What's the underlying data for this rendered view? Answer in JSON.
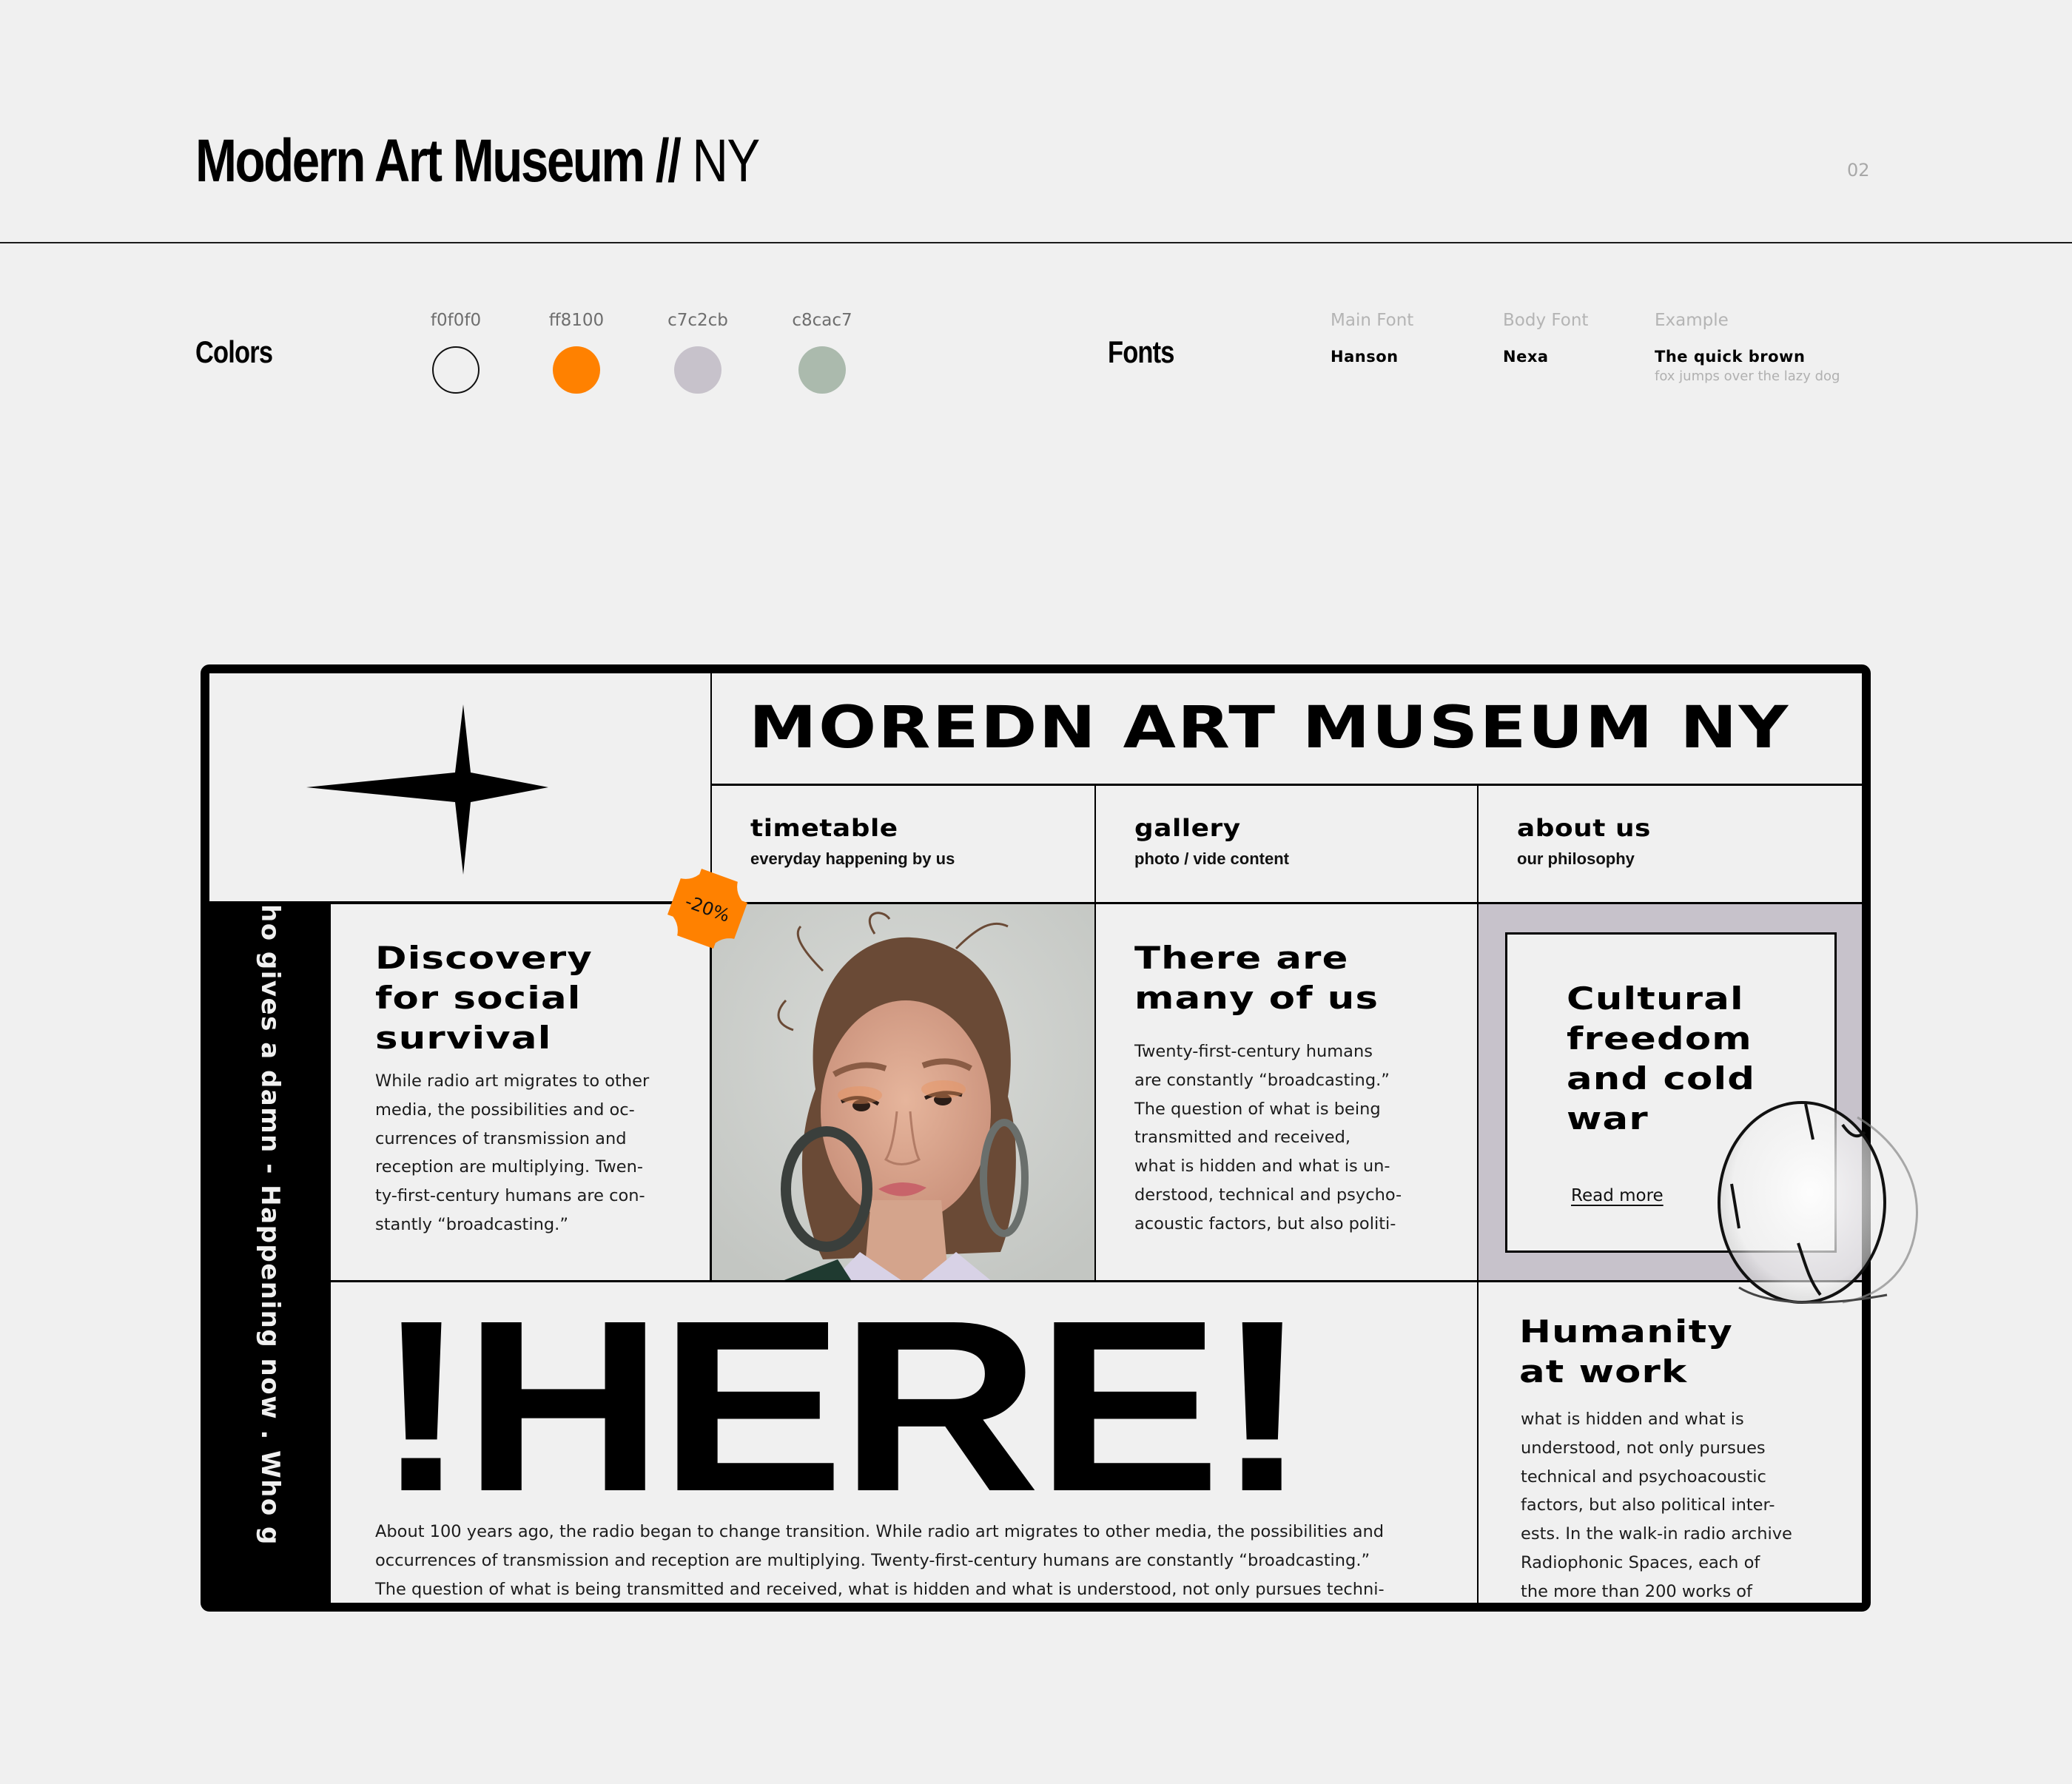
{
  "header": {
    "title_main": "Modern Art Museum",
    "title_separator": " //",
    "title_suffix": " NY",
    "page_number": "02"
  },
  "colors": {
    "label": "Colors",
    "swatches": [
      {
        "hex": "f0f0f0",
        "value": "#f0f0f0",
        "outlined": true
      },
      {
        "hex": "ff8100",
        "value": "#ff8100",
        "outlined": false
      },
      {
        "hex": "c7c2cb",
        "value": "#c7c2cb",
        "outlined": false
      },
      {
        "hex": "c8cac7",
        "value": "#c8cac7",
        "outlined": false
      }
    ]
  },
  "fonts": {
    "label": "Fonts",
    "main": {
      "label": "Main Font",
      "value": "Hanson"
    },
    "body": {
      "label": "Body Font",
      "value": "Nexa"
    },
    "example": {
      "label": "Example",
      "value": "The quick brown",
      "sub": "fox jumps over the lazy dog"
    }
  },
  "mockup": {
    "logo_icon": "four-point-star-icon",
    "site_title": "MOREDN ART MUSEUM NY",
    "nav": [
      {
        "label": "timetable",
        "sub": "everyday happening by us"
      },
      {
        "label": "gallery",
        "sub": "photo / vide content"
      },
      {
        "label": "about us",
        "sub": "our philosophy"
      }
    ],
    "marquee": "ho gives a damn - Happening now . Who g",
    "badge": {
      "text": "-20%",
      "color": "#ff8100"
    },
    "discovery": {
      "heading": "Discovery\nfor social\nsurvival",
      "heading_lines": [
        "Discovery",
        "for social",
        "survival"
      ],
      "body": "While radio art migrates to other\nmedia, the possibilities and oc-\ncurrences of transmission and\nreception are multiplying. Twen-\nty-first-century humans are con-\nstantly “broadcasting.”"
    },
    "photo": {
      "alt": "portrait of a woman with hoop earrings"
    },
    "many": {
      "heading_lines": [
        "There are",
        "many of us"
      ],
      "body": "Twenty-first-century humans\nare constantly “broadcasting.”\nThe question of what is being\ntransmitted and received,\nwhat is hidden and what is un-\nderstood, technical and psycho-\nacoustic factors, but also politi-"
    },
    "cultural": {
      "heading_lines": [
        "Cultural",
        "freedom",
        "and cold",
        "war"
      ],
      "link": "Read more"
    },
    "here": {
      "word": "!HERE!",
      "body": "About 100 years ago, the radio began to change transition. While radio art migrates to other media, the possibilities and\noccurrences of transmission and reception are multiplying.  Twenty-first-century humans are constantly “broadcasting.”\nThe question of what is being transmitted and received,  what is hidden and what is understood, not only pursues techni-"
    },
    "humanity": {
      "heading_lines": [
        "Humanity",
        "at work"
      ],
      "body": "what is hidden and what is\nunderstood, not only pursues\ntechnical and psychoacoustic\nfactors, but also political inter-\nests. In the walk-in radio archive\nRadiophonic Spaces, each of\nthe more than 200 works of"
    }
  }
}
